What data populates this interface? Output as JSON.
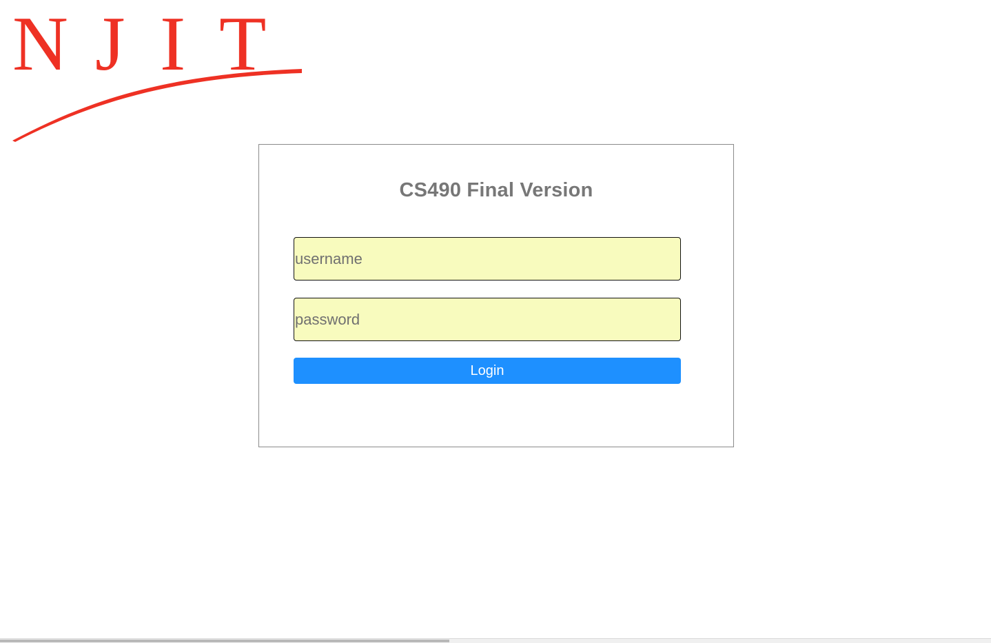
{
  "logo": {
    "text": "NJIT",
    "letters": [
      "N",
      "J",
      "I",
      "T"
    ],
    "color": "#ee3124"
  },
  "login": {
    "title": "CS490 Final Version",
    "username_placeholder": "username",
    "password_placeholder": "password",
    "button_label": "Login",
    "button_color": "#1e90ff",
    "input_background": "#f8fbbe"
  }
}
